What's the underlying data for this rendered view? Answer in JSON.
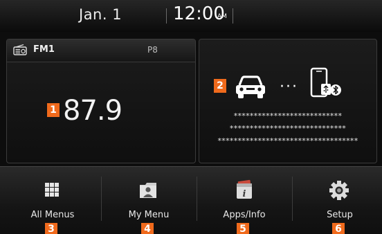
{
  "status_bar": {
    "date": "Jan.  1",
    "time": "12:00",
    "ampm": "AM"
  },
  "radio": {
    "band": "FM1",
    "preset": "P8",
    "frequency": "87.9",
    "badge": "1",
    "icon": "radio-icon"
  },
  "phone": {
    "badge": "2",
    "dots": "···",
    "icons": [
      "car-icon",
      "phone-icon",
      "usb-icon",
      "bluetooth-icon"
    ],
    "mask_lines": [
      "***************************",
      "*****************************",
      "***********************************"
    ]
  },
  "menu": {
    "items": [
      {
        "label": "All Menus",
        "number": "3",
        "icon": "grid-icon"
      },
      {
        "label": "My Menu",
        "number": "4",
        "icon": "person-icon"
      },
      {
        "label": "Apps/Info",
        "number": "5",
        "icon": "info-icon"
      },
      {
        "label": "Setup",
        "number": "6",
        "icon": "gear-icon"
      }
    ]
  },
  "colors": {
    "accent": "#f06a1c",
    "background": "#0d0d0d"
  }
}
